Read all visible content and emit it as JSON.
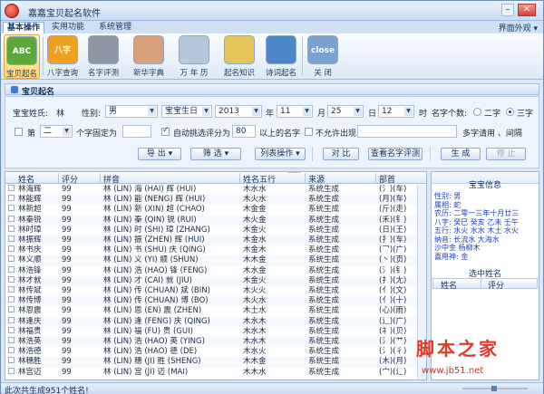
{
  "window": {
    "title": "嘉嘉宝贝起名软件",
    "minimize": "–",
    "close": "✕"
  },
  "tabs": [
    {
      "label": "基本操作"
    },
    {
      "label": "实用功能"
    },
    {
      "label": "系统管理"
    }
  ],
  "theme_label": "界面外观 ▾",
  "ribbon": [
    {
      "label": "宝贝起名",
      "icon": "abc-icon",
      "text": "ABC",
      "color": "#5ea83a"
    },
    {
      "label": "八字查询",
      "icon": "bazi-icon",
      "text": "八字",
      "color": "#f0a020"
    },
    {
      "label": "名字评测",
      "icon": "evaluate-icon",
      "text": "",
      "color": "#8c96a4"
    },
    {
      "label": "新华字典",
      "icon": "dictionary-icon",
      "text": "",
      "color": "#d7a07a"
    },
    {
      "label": "万 年 历",
      "icon": "calendar-icon",
      "text": "",
      "color": "#b8c8dc"
    },
    {
      "label": "起名知识",
      "icon": "notepad-icon",
      "text": "",
      "color": "#e6c55a"
    },
    {
      "label": "诗词起名",
      "icon": "books-icon",
      "text": "",
      "color": "#4a86c8"
    },
    {
      "label": "关  闭",
      "icon": "close-icon",
      "text": "close",
      "color": "#7aa2d0"
    }
  ],
  "panel": {
    "title": "宝贝起名"
  },
  "form": {
    "surname_label": "宝宝姓氏:",
    "surname": "林",
    "gender_label": "性别:",
    "gender": "男",
    "birth_label": "宝宝生日",
    "year": "2013",
    "year_unit": "年",
    "month": "11",
    "month_unit": "月",
    "day": "25",
    "day_unit": "日",
    "hour": "12",
    "hour_unit": "时",
    "char_count_label": "名字个数:",
    "opt_two": "二字",
    "opt_three": "三字",
    "pos_label": "第",
    "pos_value": "二",
    "pos_suffix": "个字固定为",
    "auto_filter": "自动挑选评分为",
    "score": "80",
    "score_suffix": "以上的名字",
    "disallow": "不允许出现:",
    "common_label": "多字请用 、间隔"
  },
  "toolbar": {
    "export": "导 出",
    "filter": "筛 选",
    "list_ops": "列表操作",
    "compare": "对 比",
    "eval_selected": "查看名字评测",
    "generate": "生 成",
    "stop": "停 止"
  },
  "table": {
    "columns": [
      "姓名",
      "评分",
      "拼音",
      "姓名五行",
      "来源",
      "部首"
    ],
    "rows": [
      [
        "林海辉",
        "99",
        "林 (LIN)  海 (HAI)  辉 (HUI)",
        "木水水",
        "系统生成",
        "(氵)(车)"
      ],
      [
        "林能辉",
        "99",
        "林 (LIN)  能 (NENG)  辉 (HUI)",
        "木火水",
        "系统生成",
        "(月)(车)"
      ],
      [
        "林新超",
        "99",
        "林 (LIN)  新 (XIN)  超 (CHAO)",
        "木金金",
        "系统生成",
        "(斤)(走)"
      ],
      [
        "林秦锐",
        "99",
        "林 (LIN)  秦 (QIN)  锐 (RUI)",
        "木火金",
        "系统生成",
        "(禾)(钅)"
      ],
      [
        "林时璋",
        "99",
        "林 (LIN)  时 (SHI)  璋 (ZHANG)",
        "木金火",
        "系统生成",
        "(日)(王)"
      ],
      [
        "林振辉",
        "99",
        "林 (LIN)  振 (ZHEN)  辉 (HUI)",
        "木金水",
        "系统生成",
        "(扌)(车)"
      ],
      [
        "林书庆",
        "99",
        "林 (LIN)  书 (SHU)  庆 (QING)",
        "木金木",
        "系统生成",
        "(乛)(广)"
      ],
      [
        "林义顺",
        "99",
        "林 (LIN)  义 (YI)  顺 (SHUN)",
        "木木金",
        "系统生成",
        "(丶)(页)"
      ],
      [
        "林浩锋",
        "99",
        "林 (LIN)  浩 (HAO)  锋 (FENG)",
        "木水金",
        "系统生成",
        "(氵)(钅)"
      ],
      [
        "林才就",
        "99",
        "林 (LIN)  才 (CAI)  就 (JIU)",
        "木金火",
        "系统生成",
        "(扌)(尢)"
      ],
      [
        "林传斌",
        "99",
        "林 (LIN)  传 (CHUAN)  斌 (BIN)",
        "木火火",
        "系统生成",
        "(亻)(文)"
      ],
      [
        "林传博",
        "99",
        "林 (LIN)  传 (CHUAN)  博 (BO)",
        "木火水",
        "系统生成",
        "(亻)(十)"
      ],
      [
        "林恩震",
        "99",
        "林 (LIN)  恩 (EN)  震 (ZHEN)",
        "木土水",
        "系统生成",
        "(心)(雨)"
      ],
      [
        "林逢庆",
        "99",
        "林 (LIN)  逢 (FENG)  庆 (QING)",
        "木水木",
        "系统生成",
        "(辶)(广)"
      ],
      [
        "林福贵",
        "99",
        "林 (LIN)  福 (FU)  贵 (GUI)",
        "木水木",
        "系统生成",
        "(礻)(贝)"
      ],
      [
        "林浩英",
        "99",
        "林 (LIN)  浩 (HAO)  英 (YING)",
        "木水木",
        "系统生成",
        "(氵)(艹)"
      ],
      [
        "林浩德",
        "99",
        "林 (LIN)  浩 (HAO)  德 (DE)",
        "木水火",
        "系统生成",
        "(氵)(彳)"
      ],
      [
        "林穗胜",
        "99",
        "林 (LIN)  穗 (JI)  胜 (SHENG)",
        "木木金",
        "系统生成",
        "(木)(月)"
      ],
      [
        "林宫迈",
        "99",
        "林 (LIN)  宫 (JI)  迈 (MAI)",
        "木木水",
        "系统生成",
        "(宀)(辶)"
      ]
    ]
  },
  "side": {
    "info_title": "宝宝信息",
    "info_lines": [
      "性别: 男",
      "属相: 蛇",
      "农历: 二零一三年十月廿三",
      "八字: 癸巳 癸亥 乙未 壬午",
      "五行: 水火 水水 木土 水火",
      "纳音: 长流水 大海水",
      "     沙中金 杨柳木",
      "喜用神: 金"
    ],
    "selected_title": "选中姓名",
    "selected_columns": [
      "姓名",
      "评分"
    ]
  },
  "status": "此次共生成951个姓名!",
  "watermark": {
    "title": "脚本之家",
    "url": "www.jb51.net"
  }
}
